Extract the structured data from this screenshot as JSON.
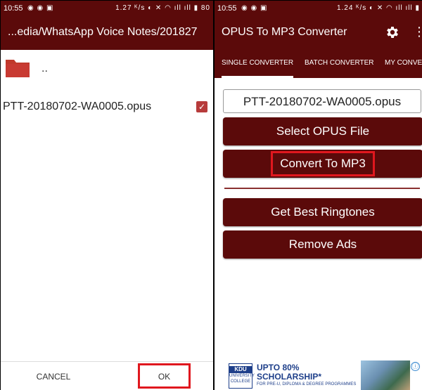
{
  "left_panel": {
    "status_bar": {
      "time": "10:55",
      "notification_icons": "◉ ◉ ▣",
      "right_text": "1.27 ᴷ/s ◐ ✕ ◠ ıll ıll ▮ 80"
    },
    "toolbar": {
      "title": "...edia/WhatsApp Voice Notes/201827"
    },
    "folder_row": {
      "label": ".."
    },
    "file_row": {
      "filename": "PTT-20180702-WA0005.opus",
      "checked": true
    },
    "bottom_bar": {
      "cancel_label": "CANCEL",
      "ok_label": "OK"
    }
  },
  "right_panel": {
    "status_bar": {
      "time": "10:55",
      "notification_icons": "◉ ◉ ▣",
      "right_text": "1.24 ᴷ/s ◐ ✕ ◠ ıll ıll ▮"
    },
    "toolbar": {
      "title": "OPUS To MP3 Converter",
      "more_icon": "⋮"
    },
    "tabs": [
      {
        "label": "SINGLE CONVERTER"
      },
      {
        "label": "BATCH CONVERTER"
      },
      {
        "label": "MY CONVERT"
      }
    ],
    "filename": "PTT-20180702-WA0005.opus",
    "buttons": {
      "select": "Select OPUS File",
      "convert": "Convert To MP3",
      "ringtones": "Get Best Ringtones",
      "remove_ads": "Remove Ads"
    },
    "ad": {
      "logo_top": "KDU",
      "logo_bottom": "UNIVERSITY COLLEGE",
      "headline_1": "UPTO 80%",
      "headline_2": "SCHOLARSHIP*",
      "subline": "FOR PRE-U, DIPLOMA & DEGREE PROGRAMMES",
      "info_icon": "ⓘ"
    }
  },
  "colors": {
    "brand": "#5b0a0a",
    "highlight": "#e0171e",
    "checkbox": "#b73b3b"
  }
}
